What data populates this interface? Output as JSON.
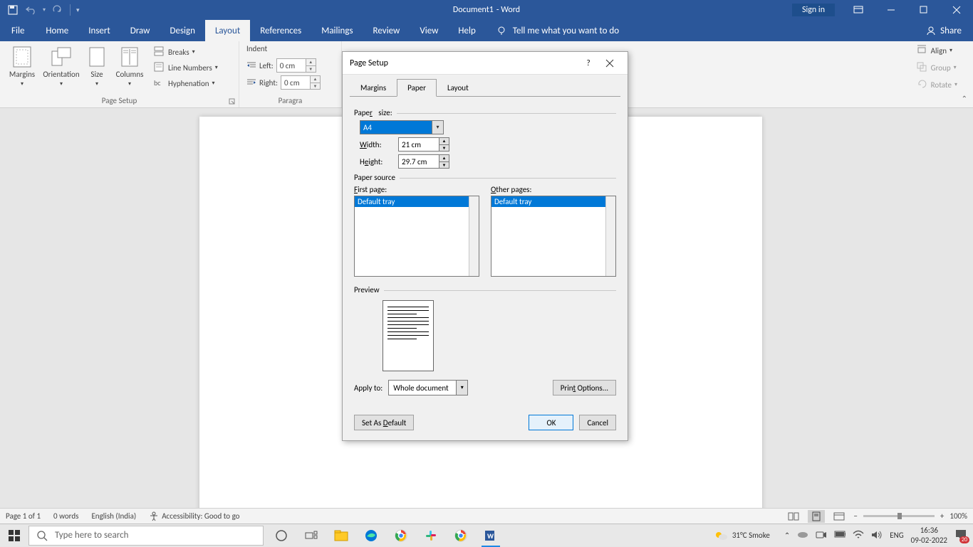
{
  "titlebar": {
    "doc_name": "Document1",
    "app_suffix": " - Word",
    "signin": "Sign in"
  },
  "menu": {
    "file": "File",
    "tabs": [
      "Home",
      "Insert",
      "Draw",
      "Design",
      "Layout",
      "References",
      "Mailings",
      "Review",
      "View",
      "Help"
    ],
    "active": "Layout",
    "tellme": "Tell me what you want to do",
    "share": "Share"
  },
  "ribbon": {
    "page_setup": {
      "label": "Page Setup",
      "margins": "Margins",
      "orientation": "Orientation",
      "size": "Size",
      "columns": "Columns",
      "breaks": "Breaks",
      "line_numbers": "Line Numbers",
      "hyphenation": "Hyphenation"
    },
    "paragraph": {
      "label": "Paragra",
      "indent": "Indent",
      "left": "Left:",
      "right": "Right:",
      "left_val": "0 cm",
      "right_val": "0 cm"
    },
    "arrange": {
      "align": "Align",
      "group": "Group",
      "rotate": "Rotate"
    }
  },
  "dialog": {
    "title": "Page Setup",
    "tabs": {
      "margins": "Margins",
      "paper": "Paper",
      "layout": "Layout"
    },
    "paper_size_label": "Paper size:",
    "paper_size_value": "A4",
    "width_label": "Width:",
    "width_value": "21 cm",
    "height_label": "Height:",
    "height_value": "29.7 cm",
    "paper_source_label": "Paper source",
    "first_page_label": "First page:",
    "other_pages_label": "Other pages:",
    "tray_option": "Default tray",
    "preview_label": "Preview",
    "apply_to_label": "Apply to:",
    "apply_to_value": "Whole document",
    "print_options": "Print Options...",
    "set_default": "Set As Default",
    "ok": "OK",
    "cancel": "Cancel"
  },
  "statusbar": {
    "page": "Page 1 of 1",
    "words": "0 words",
    "lang": "English (India)",
    "accessibility": "Accessibility: Good to go",
    "zoom": "100%"
  },
  "taskbar": {
    "search_placeholder": "Type here to search",
    "weather": "31°C Smoke",
    "lang": "ENG",
    "time": "16:36",
    "date": "09-02-2022",
    "notif_count": "20"
  }
}
